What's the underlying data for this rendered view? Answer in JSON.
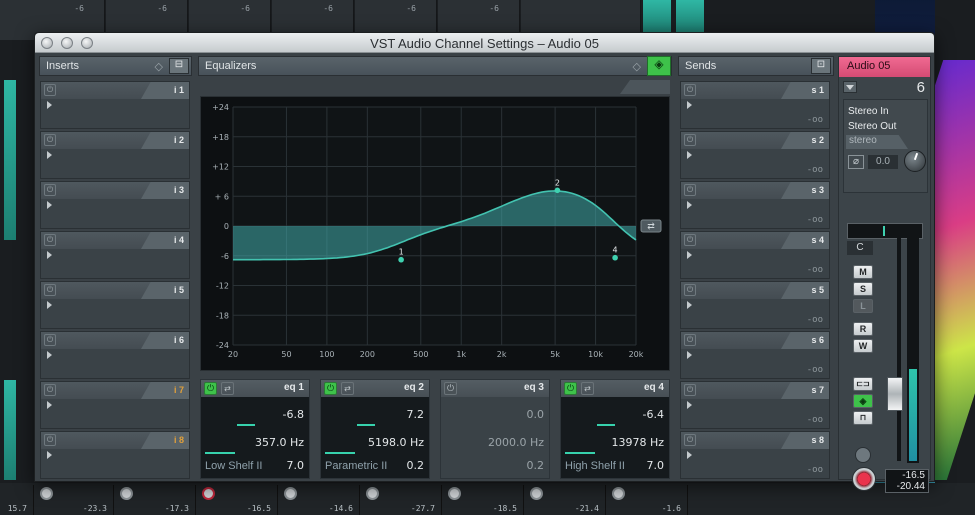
{
  "window": {
    "title": "VST Audio Channel Settings – Audio 05"
  },
  "background": {
    "top_values": [
      "-6",
      "-6",
      "-6",
      "-6",
      "-6",
      "-6"
    ],
    "bottom_values": [
      "15.7",
      "-23.3",
      "-17.3",
      "-16.5",
      "-14.6",
      "-27.7",
      "-18.5",
      "-21.4",
      "-1.6"
    ]
  },
  "inserts": {
    "title": "Inserts",
    "slots": [
      {
        "label": "i 1",
        "highlight": false
      },
      {
        "label": "i 2",
        "highlight": false
      },
      {
        "label": "i 3",
        "highlight": false
      },
      {
        "label": "i 4",
        "highlight": false
      },
      {
        "label": "i 5",
        "highlight": false
      },
      {
        "label": "i 6",
        "highlight": false
      },
      {
        "label": "i 7",
        "highlight": true
      },
      {
        "label": "i 8",
        "highlight": true
      }
    ]
  },
  "equalizers": {
    "title": "Equalizers",
    "y_ticks": [
      "+24",
      "+18",
      "+12",
      "+ 6",
      "0",
      "-6",
      "-12",
      "-18",
      "-24"
    ],
    "x_ticks": [
      "20",
      "50",
      "100",
      "200",
      "500",
      "1k",
      "2k",
      "5k",
      "10k",
      "20k"
    ],
    "points": [
      {
        "label": "1",
        "freq": 357,
        "gain": -6.8
      },
      {
        "label": "2",
        "freq": 5198,
        "gain": 7.2
      },
      {
        "label": "4",
        "freq": 13978,
        "gain": -6.4
      }
    ],
    "bands": [
      {
        "label": "eq 1",
        "enabled": true,
        "gain": "-6.8",
        "freq": "357.0 Hz",
        "type": "Low Shelf II",
        "q": "7.0"
      },
      {
        "label": "eq 2",
        "enabled": true,
        "gain": "7.2",
        "freq": "5198.0 Hz",
        "type": "Parametric II",
        "q": "0.2"
      },
      {
        "label": "eq 3",
        "enabled": false,
        "gain": "0.0",
        "freq": "2000.0 Hz",
        "type": "",
        "q": "0.2"
      },
      {
        "label": "eq 4",
        "enabled": true,
        "gain": "-6.4",
        "freq": "13978 Hz",
        "type": "High Shelf II",
        "q": "7.0"
      }
    ]
  },
  "sends": {
    "title": "Sends",
    "slots": [
      {
        "label": "s 1",
        "value": "-oo"
      },
      {
        "label": "s 2",
        "value": "-oo"
      },
      {
        "label": "s 3",
        "value": "-oo"
      },
      {
        "label": "s 4",
        "value": "-oo"
      },
      {
        "label": "s 5",
        "value": "-oo"
      },
      {
        "label": "s 6",
        "value": "-oo"
      },
      {
        "label": "s 7",
        "value": "-oo"
      },
      {
        "label": "s 8",
        "value": "-oo"
      }
    ]
  },
  "channel": {
    "name": "Audio 05",
    "number": "6",
    "input": "Stereo In",
    "output": "Stereo Out",
    "config": "stereo",
    "pan_value": "0.0",
    "pan_label": "C",
    "buttons": {
      "mute": "M",
      "solo": "S",
      "listen": "L",
      "read": "R",
      "write": "W"
    },
    "level_peak": "-16.5",
    "level_fader": "-20.44",
    "accent": "#e2517d"
  }
}
